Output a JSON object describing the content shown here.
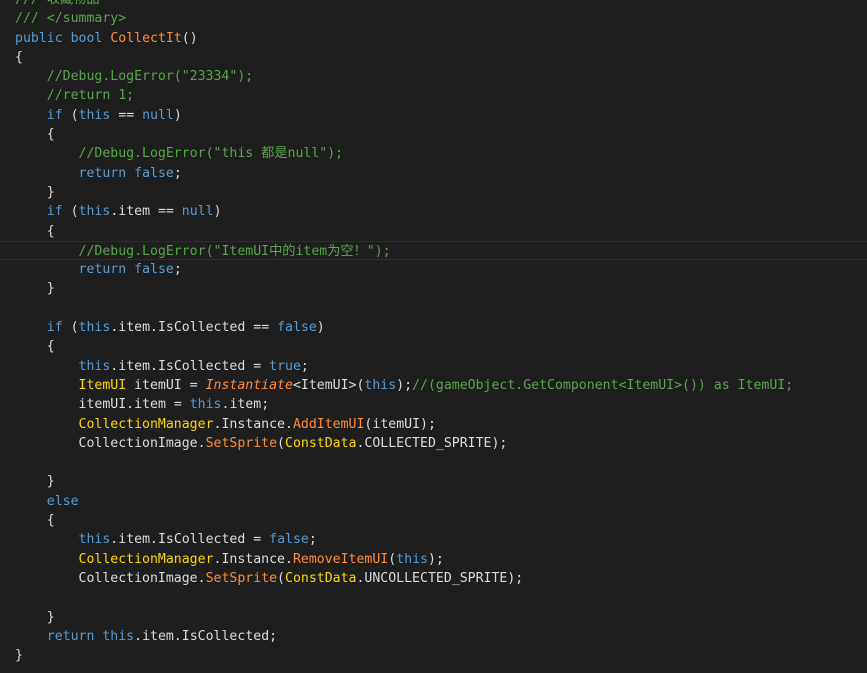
{
  "editor": {
    "language": "C#",
    "colors": {
      "background": "#1e1e1e",
      "keyword": "#569cd6",
      "comment": "#57a64a",
      "method": "#ff8c3a",
      "type": "#ffd700",
      "plain": "#dcdcdc"
    },
    "lines": [
      {
        "tokens": [
          {
            "t": "cm",
            "v": "/// 收藏物品"
          }
        ]
      },
      {
        "tokens": [
          {
            "t": "cm",
            "v": "/// </summary>"
          }
        ]
      },
      {
        "tokens": [
          {
            "t": "kw",
            "v": "public"
          },
          {
            "t": "pl",
            "v": " "
          },
          {
            "t": "kw",
            "v": "bool"
          },
          {
            "t": "pl",
            "v": " "
          },
          {
            "t": "fn",
            "v": "CollectIt"
          },
          {
            "t": "pu",
            "v": "()"
          }
        ]
      },
      {
        "tokens": [
          {
            "t": "pu",
            "v": "{"
          }
        ]
      },
      {
        "tokens": [
          {
            "t": "pl",
            "v": "    "
          },
          {
            "t": "cm",
            "v": "//Debug.LogError(\"23334\");"
          }
        ]
      },
      {
        "tokens": [
          {
            "t": "pl",
            "v": "    "
          },
          {
            "t": "cm",
            "v": "//return 1;"
          }
        ]
      },
      {
        "tokens": [
          {
            "t": "pl",
            "v": "    "
          },
          {
            "t": "kw",
            "v": "if"
          },
          {
            "t": "pu",
            "v": " ("
          },
          {
            "t": "kw",
            "v": "this"
          },
          {
            "t": "pu",
            "v": " == "
          },
          {
            "t": "kw",
            "v": "null"
          },
          {
            "t": "pu",
            "v": ")"
          }
        ]
      },
      {
        "tokens": [
          {
            "t": "pl",
            "v": "    "
          },
          {
            "t": "pu",
            "v": "{"
          }
        ]
      },
      {
        "tokens": [
          {
            "t": "pl",
            "v": "        "
          },
          {
            "t": "cm",
            "v": "//Debug.LogError(\"this 都是null\");"
          }
        ]
      },
      {
        "tokens": [
          {
            "t": "pl",
            "v": "        "
          },
          {
            "t": "kw",
            "v": "return"
          },
          {
            "t": "pl",
            "v": " "
          },
          {
            "t": "kw",
            "v": "false"
          },
          {
            "t": "pu",
            "v": ";"
          }
        ]
      },
      {
        "tokens": [
          {
            "t": "pl",
            "v": "    "
          },
          {
            "t": "pu",
            "v": "}"
          }
        ]
      },
      {
        "tokens": [
          {
            "t": "pl",
            "v": "    "
          },
          {
            "t": "kw",
            "v": "if"
          },
          {
            "t": "pu",
            "v": " ("
          },
          {
            "t": "kw",
            "v": "this"
          },
          {
            "t": "pu",
            "v": "."
          },
          {
            "t": "pl",
            "v": "item"
          },
          {
            "t": "pu",
            "v": " == "
          },
          {
            "t": "kw",
            "v": "null"
          },
          {
            "t": "pu",
            "v": ")"
          }
        ]
      },
      {
        "tokens": [
          {
            "t": "pl",
            "v": "    "
          },
          {
            "t": "pu",
            "v": "{"
          }
        ]
      },
      {
        "current": true,
        "tokens": [
          {
            "t": "pl",
            "v": "        "
          },
          {
            "t": "cm",
            "v": "//Debug.LogError(\"ItemUI中的item为空！\");"
          }
        ]
      },
      {
        "tokens": [
          {
            "t": "pl",
            "v": "        "
          },
          {
            "t": "kw",
            "v": "return"
          },
          {
            "t": "pl",
            "v": " "
          },
          {
            "t": "kw",
            "v": "false"
          },
          {
            "t": "pu",
            "v": ";"
          }
        ]
      },
      {
        "tokens": [
          {
            "t": "pl",
            "v": "    "
          },
          {
            "t": "pu",
            "v": "}"
          }
        ]
      },
      {
        "tokens": []
      },
      {
        "tokens": [
          {
            "t": "pl",
            "v": "    "
          },
          {
            "t": "kw",
            "v": "if"
          },
          {
            "t": "pu",
            "v": " ("
          },
          {
            "t": "kw",
            "v": "this"
          },
          {
            "t": "pu",
            "v": "."
          },
          {
            "t": "pl",
            "v": "item"
          },
          {
            "t": "pu",
            "v": "."
          },
          {
            "t": "pl",
            "v": "IsCollected"
          },
          {
            "t": "pu",
            "v": " == "
          },
          {
            "t": "kw",
            "v": "false"
          },
          {
            "t": "pu",
            "v": ")"
          }
        ]
      },
      {
        "tokens": [
          {
            "t": "pl",
            "v": "    "
          },
          {
            "t": "pu",
            "v": "{"
          }
        ]
      },
      {
        "tokens": [
          {
            "t": "pl",
            "v": "        "
          },
          {
            "t": "kw",
            "v": "this"
          },
          {
            "t": "pu",
            "v": "."
          },
          {
            "t": "pl",
            "v": "item"
          },
          {
            "t": "pu",
            "v": "."
          },
          {
            "t": "pl",
            "v": "IsCollected"
          },
          {
            "t": "pu",
            "v": " = "
          },
          {
            "t": "kw",
            "v": "true"
          },
          {
            "t": "pu",
            "v": ";"
          }
        ]
      },
      {
        "tokens": [
          {
            "t": "pl",
            "v": "        "
          },
          {
            "t": "ty",
            "v": "ItemUI"
          },
          {
            "t": "pl",
            "v": " itemUI "
          },
          {
            "t": "pu",
            "v": "= "
          },
          {
            "t": "fni",
            "v": "Instantiate"
          },
          {
            "t": "pu",
            "v": "<"
          },
          {
            "t": "pl",
            "v": "ItemUI"
          },
          {
            "t": "pu",
            "v": ">("
          },
          {
            "t": "kw",
            "v": "this"
          },
          {
            "t": "pu",
            "v": ");"
          },
          {
            "t": "cm",
            "v": "//(gameObject.GetComponent<ItemUI>()) as ItemUI;"
          }
        ]
      },
      {
        "tokens": [
          {
            "t": "pl",
            "v": "        "
          },
          {
            "t": "pl",
            "v": "itemUI"
          },
          {
            "t": "pu",
            "v": "."
          },
          {
            "t": "pl",
            "v": "item"
          },
          {
            "t": "pu",
            "v": " = "
          },
          {
            "t": "kw",
            "v": "this"
          },
          {
            "t": "pu",
            "v": "."
          },
          {
            "t": "pl",
            "v": "item"
          },
          {
            "t": "pu",
            "v": ";"
          }
        ]
      },
      {
        "tokens": [
          {
            "t": "pl",
            "v": "        "
          },
          {
            "t": "ty",
            "v": "CollectionManager"
          },
          {
            "t": "pu",
            "v": "."
          },
          {
            "t": "pl",
            "v": "Instance"
          },
          {
            "t": "pu",
            "v": "."
          },
          {
            "t": "fn",
            "v": "AddItemUI"
          },
          {
            "t": "pu",
            "v": "("
          },
          {
            "t": "pl",
            "v": "itemUI"
          },
          {
            "t": "pu",
            "v": ");"
          }
        ]
      },
      {
        "tokens": [
          {
            "t": "pl",
            "v": "        "
          },
          {
            "t": "pl",
            "v": "CollectionImage"
          },
          {
            "t": "pu",
            "v": "."
          },
          {
            "t": "fn",
            "v": "SetSprite"
          },
          {
            "t": "pu",
            "v": "("
          },
          {
            "t": "ty",
            "v": "ConstData"
          },
          {
            "t": "pu",
            "v": "."
          },
          {
            "t": "pl",
            "v": "COLLECTED_SPRITE"
          },
          {
            "t": "pu",
            "v": ");"
          }
        ]
      },
      {
        "tokens": []
      },
      {
        "tokens": [
          {
            "t": "pl",
            "v": "    "
          },
          {
            "t": "pu",
            "v": "}"
          }
        ]
      },
      {
        "tokens": [
          {
            "t": "pl",
            "v": "    "
          },
          {
            "t": "kw",
            "v": "else"
          }
        ]
      },
      {
        "tokens": [
          {
            "t": "pl",
            "v": "    "
          },
          {
            "t": "pu",
            "v": "{"
          }
        ]
      },
      {
        "tokens": [
          {
            "t": "pl",
            "v": "        "
          },
          {
            "t": "kw",
            "v": "this"
          },
          {
            "t": "pu",
            "v": "."
          },
          {
            "t": "pl",
            "v": "item"
          },
          {
            "t": "pu",
            "v": "."
          },
          {
            "t": "pl",
            "v": "IsCollected"
          },
          {
            "t": "pu",
            "v": " = "
          },
          {
            "t": "kw",
            "v": "false"
          },
          {
            "t": "pu",
            "v": ";"
          }
        ]
      },
      {
        "tokens": [
          {
            "t": "pl",
            "v": "        "
          },
          {
            "t": "ty",
            "v": "CollectionManager"
          },
          {
            "t": "pu",
            "v": "."
          },
          {
            "t": "pl",
            "v": "Instance"
          },
          {
            "t": "pu",
            "v": "."
          },
          {
            "t": "fn",
            "v": "RemoveItemUI"
          },
          {
            "t": "pu",
            "v": "("
          },
          {
            "t": "kw",
            "v": "this"
          },
          {
            "t": "pu",
            "v": ");"
          }
        ]
      },
      {
        "tokens": [
          {
            "t": "pl",
            "v": "        "
          },
          {
            "t": "pl",
            "v": "CollectionImage"
          },
          {
            "t": "pu",
            "v": "."
          },
          {
            "t": "fn",
            "v": "SetSprite"
          },
          {
            "t": "pu",
            "v": "("
          },
          {
            "t": "ty",
            "v": "ConstData"
          },
          {
            "t": "pu",
            "v": "."
          },
          {
            "t": "pl",
            "v": "UNCOLLECTED_SPRITE"
          },
          {
            "t": "pu",
            "v": ");"
          }
        ]
      },
      {
        "tokens": []
      },
      {
        "tokens": [
          {
            "t": "pl",
            "v": "    "
          },
          {
            "t": "pu",
            "v": "}"
          }
        ]
      },
      {
        "tokens": [
          {
            "t": "pl",
            "v": "    "
          },
          {
            "t": "kw",
            "v": "return"
          },
          {
            "t": "pl",
            "v": " "
          },
          {
            "t": "kw",
            "v": "this"
          },
          {
            "t": "pu",
            "v": "."
          },
          {
            "t": "pl",
            "v": "item"
          },
          {
            "t": "pu",
            "v": "."
          },
          {
            "t": "pl",
            "v": "IsCollected"
          },
          {
            "t": "pu",
            "v": ";"
          }
        ]
      },
      {
        "tokens": [
          {
            "t": "pu",
            "v": "}"
          }
        ]
      }
    ]
  }
}
